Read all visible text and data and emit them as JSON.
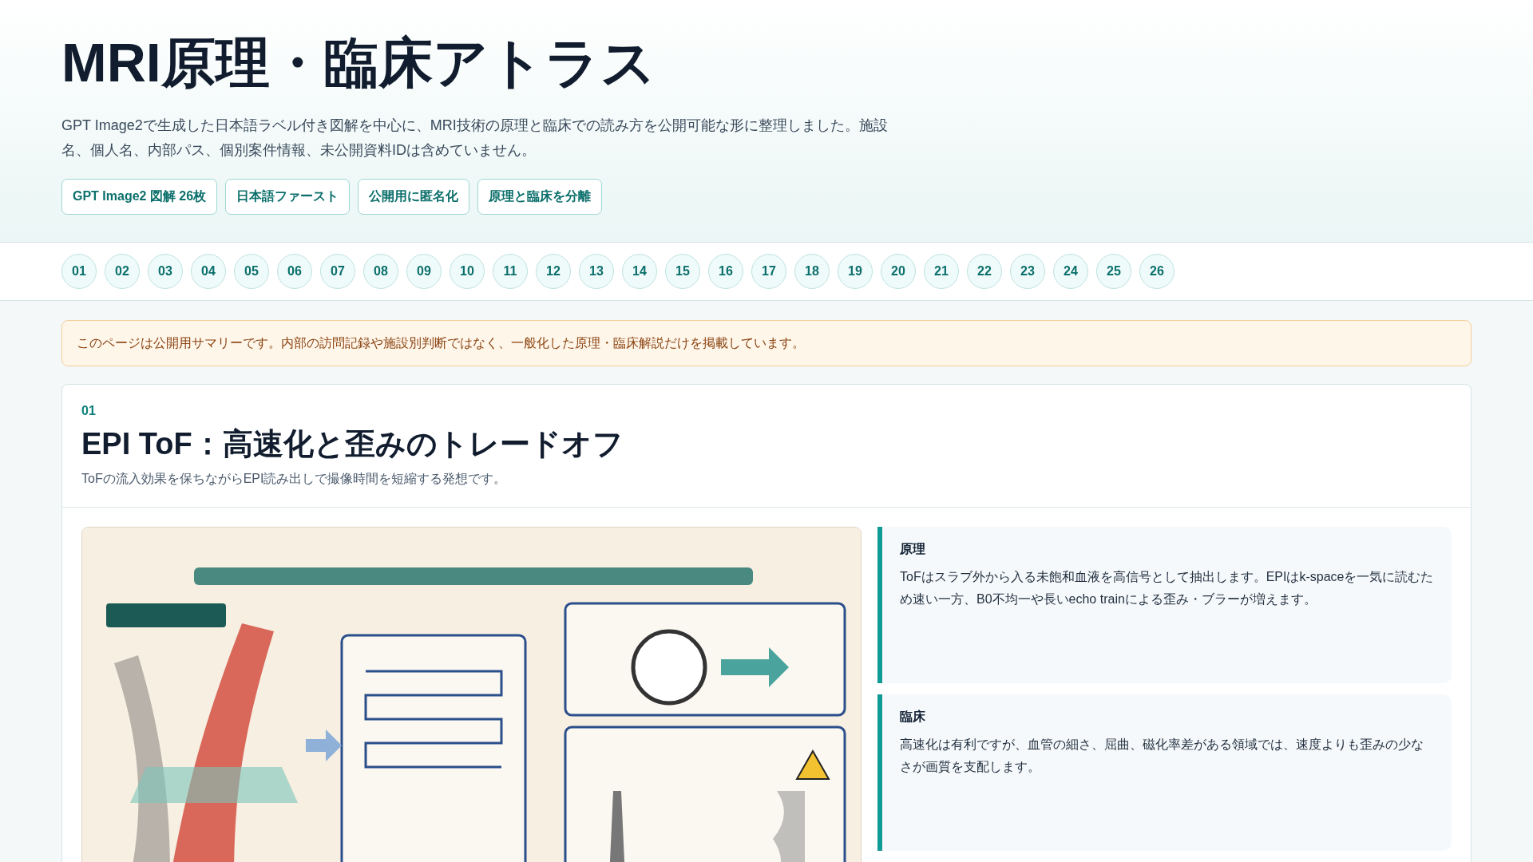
{
  "header": {
    "title": "MRI原理・臨床アトラス",
    "description": "GPT Image2で生成した日本語ラベル付き図解を中心に、MRI技術の原理と臨床での読み方を公開可能な形に整理しました。施設名、個人名、内部パス、個別案件情報、未公開資料IDは含めていません。",
    "tags": [
      "GPT Image2 図解 26枚",
      "日本語ファースト",
      "公開用に匿名化",
      "原理と臨床を分離"
    ]
  },
  "index_nav": [
    "01",
    "02",
    "03",
    "04",
    "05",
    "06",
    "07",
    "08",
    "09",
    "10",
    "11",
    "12",
    "13",
    "14",
    "15",
    "16",
    "17",
    "18",
    "19",
    "20",
    "21",
    "22",
    "23",
    "24",
    "25",
    "26"
  ],
  "notice": "このページは公開用サマリーです。内部の訪問記録や施設別判断ではなく、一般化した原理・臨床解説だけを掲載しています。",
  "sections": [
    {
      "number": "01",
      "title": "EPI ToF：高速化と歪みのトレードオフ",
      "subtitle": "ToFの流入効果を保ちながらEPI読み出しで撮像時間を短縮する発想です。",
      "notes": [
        {
          "heading": "原理",
          "text": "ToFはスラブ外から入る未飽和血液を高信号として抽出します。EPIはk-spaceを一気に読むため速い一方、B0不均一や長いecho trainによる歪み・ブラーが増えます。",
          "color": "#0f9a94"
        },
        {
          "heading": "臨床",
          "text": "高速化は有利ですが、血管の細さ、屈曲、磁化率差がある領域では、速度よりも歪みの少なさが画質を支配します。",
          "color": "#0f9a94"
        }
      ]
    }
  ]
}
